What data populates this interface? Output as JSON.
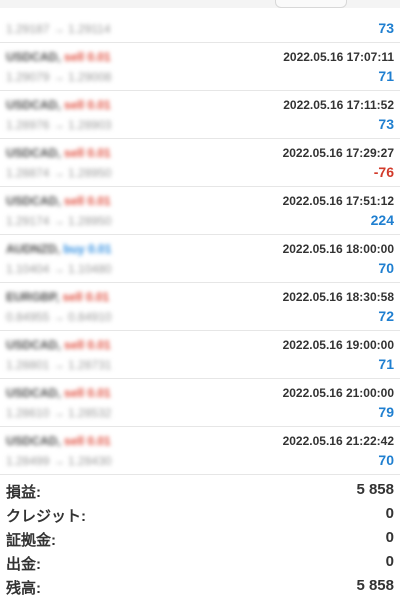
{
  "trades": [
    {
      "symbol": "",
      "type": "",
      "prices": "1.29187 → 1.29114",
      "date": "",
      "profit": "73",
      "type_class": ""
    },
    {
      "symbol": "USDCAD,",
      "type": "sell 0.01",
      "prices": "1.29079 → 1.29008",
      "date": "2022.05.16 17:07:11",
      "profit": "71",
      "type_class": "sell"
    },
    {
      "symbol": "USDCAD,",
      "type": "sell 0.01",
      "prices": "1.28976 → 1.28903",
      "date": "2022.05.16 17:11:52",
      "profit": "73",
      "type_class": "sell"
    },
    {
      "symbol": "USDCAD,",
      "type": "sell 0.01",
      "prices": "1.28874 → 1.28950",
      "date": "2022.05.16 17:29:27",
      "profit": "-76",
      "type_class": "sell"
    },
    {
      "symbol": "USDCAD,",
      "type": "sell 0.01",
      "prices": "1.29174 → 1.28950",
      "date": "2022.05.16 17:51:12",
      "profit": "224",
      "type_class": "sell"
    },
    {
      "symbol": "AUDNZD,",
      "type": "buy 0.01",
      "prices": "1.10404 → 1.10480",
      "date": "2022.05.16 18:00:00",
      "profit": "70",
      "type_class": "buy"
    },
    {
      "symbol": "EURGBP,",
      "type": "sell 0.01",
      "prices": "0.84955 → 0.84910",
      "date": "2022.05.16 18:30:58",
      "profit": "72",
      "type_class": "sell"
    },
    {
      "symbol": "USDCAD,",
      "type": "sell 0.01",
      "prices": "1.28801 → 1.28731",
      "date": "2022.05.16 19:00:00",
      "profit": "71",
      "type_class": "sell"
    },
    {
      "symbol": "USDCAD,",
      "type": "sell 0.01",
      "prices": "1.28610 → 1.28532",
      "date": "2022.05.16 21:00:00",
      "profit": "79",
      "type_class": "sell"
    },
    {
      "symbol": "USDCAD,",
      "type": "sell 0.01",
      "prices": "1.28499 → 1.28430",
      "date": "2022.05.16 21:22:42",
      "profit": "70",
      "type_class": "sell"
    }
  ],
  "summary": {
    "profit_label": "損益:",
    "profit_value": "5 858",
    "credit_label": "クレジット:",
    "credit_value": "0",
    "margin_label": "証拠金:",
    "margin_value": "0",
    "withdrawal_label": "出金:",
    "withdrawal_value": "0",
    "balance_label": "残高:",
    "balance_value": "5 858"
  },
  "colors": {
    "profit_positive": "#1f7fd0",
    "profit_negative": "#d23a2a",
    "sell": "#e04a3a",
    "buy": "#2a8be0"
  }
}
